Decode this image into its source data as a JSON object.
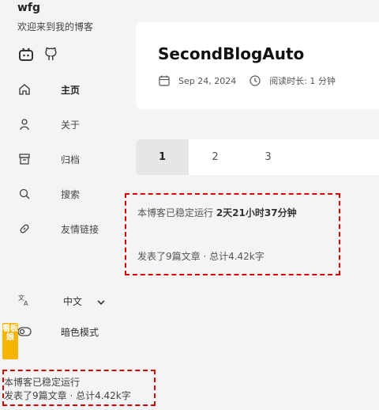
{
  "site": {
    "title": "wfg",
    "subtitle": "欢迎来到我的博客"
  },
  "social": [
    {
      "name": "bilibili-icon"
    },
    {
      "name": "github-icon"
    }
  ],
  "menu": [
    {
      "label": "主页",
      "icon": "home-icon",
      "active": true
    },
    {
      "label": "关于",
      "icon": "user-icon"
    },
    {
      "label": "归档",
      "icon": "archive-icon"
    },
    {
      "label": "搜索",
      "icon": "search-icon"
    },
    {
      "label": "友情链接",
      "icon": "link-icon"
    }
  ],
  "language": {
    "label": "中文",
    "icon": "translate-icon"
  },
  "dark_mode": {
    "label": "暗色模式",
    "icon": "toggle-icon"
  },
  "mascot": {
    "label": "看板娘"
  },
  "post": {
    "title": "SecondBlogAuto",
    "date": "Sep 24, 2024",
    "read_time": "阅读时长: 1 分钟"
  },
  "pagination": {
    "pages": [
      "1",
      "2",
      "3"
    ],
    "current": "1"
  },
  "stats_main": {
    "running_prefix": "本博客已稳定运行 ",
    "running_time": "2天21小时37分钟",
    "summary": "发表了9篇文章 · 总计4.42k字"
  },
  "stats_footer": {
    "line1": "本博客已稳定运行",
    "line2": "发表了9篇文章 · 总计4.42k字"
  },
  "colors": {
    "accent_dashed": "#dd0000",
    "mascot": "#f4b400"
  }
}
